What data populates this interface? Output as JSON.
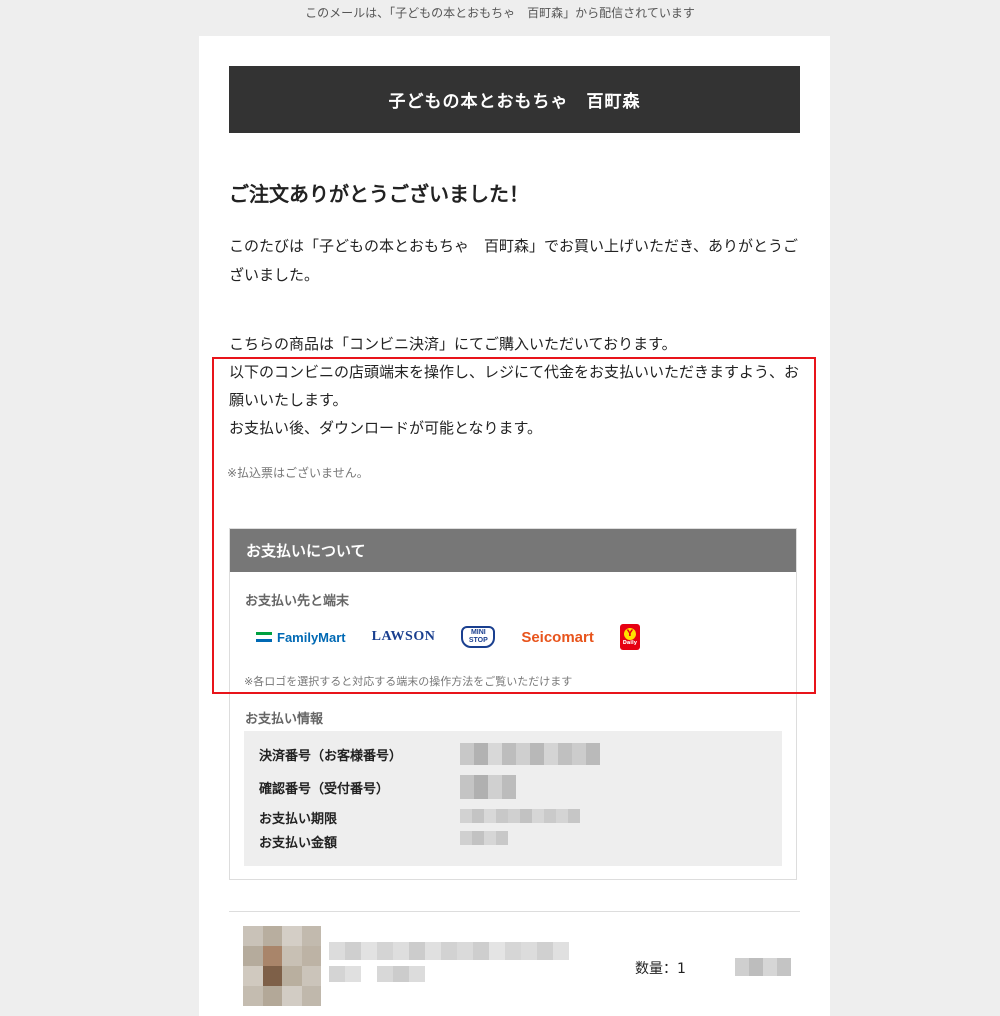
{
  "preheader": "このメールは、「子どもの本とおもちゃ　百町森」から配信されています",
  "shop_name": "子どもの本とおもちゃ　百町森",
  "thanks_title": "ご注文ありがとうございました！",
  "intro": "このたびは「子どもの本とおもちゃ　百町森」でお買い上げいただき、ありがとうございました。",
  "method_lines": [
    "こちらの商品は「コンビニ決済」にてご購入いただいております。",
    "以下のコンビニの店頭端末を操作し、レジにて代金をお支払いいただきますよう、お願いいたします。",
    "お支払い後、ダウンロードが可能となります。"
  ],
  "note": "※払込票はございません。",
  "payment": {
    "header": "お支払いについて",
    "destinations_label": "お支払い先と端末",
    "logos": {
      "familymart": "FamilyMart",
      "lawson": "LAWSON",
      "ministop_top": "MINI",
      "ministop_bottom": "STOP",
      "seicomart": "Seicomart",
      "daily_mark": "Y",
      "daily_text": "Daily"
    },
    "logo_note": "※各ロゴを選択すると対応する端末の操作方法をご覧いただけます",
    "info_label": "お支払い情報",
    "info_rows": [
      "決済番号（お客様番号）",
      "確認番号（受付番号）",
      "お支払い期限",
      "お支払い金額"
    ]
  },
  "item": {
    "quantity": "数量：1"
  },
  "colors": {
    "highlight_frame": "#e8141a",
    "familymart_blue": "#0069b4",
    "familymart_green": "#00a040",
    "lawson_blue": "#1a3f8f",
    "seicomart_orange": "#e8541c",
    "daily_red": "#e60012"
  }
}
